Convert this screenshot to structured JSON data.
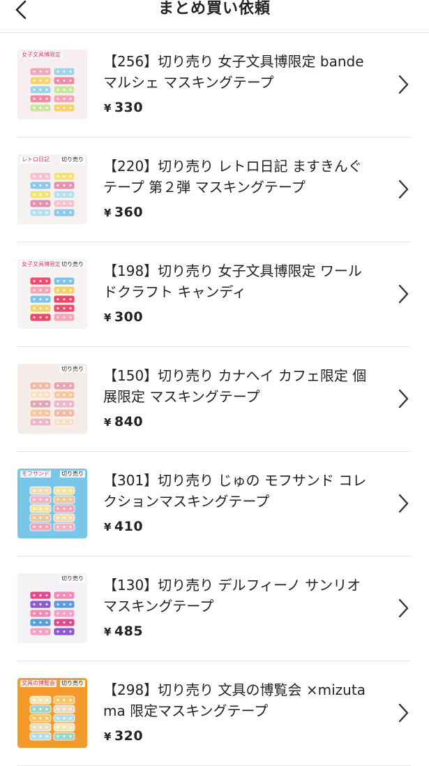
{
  "header": {
    "title": "まとめ買い依頼",
    "back_icon": "chevron-left-icon"
  },
  "items": [
    {
      "title": "【256】切り売り 女子文具博限定 bande マルシェ マスキングテープ",
      "currency": "¥",
      "price": "330",
      "thumb_caption": "女子文具博限定",
      "thumb_caption2": "",
      "thumb_bg": "#f6eef0",
      "thumb_colors": [
        "#f3a6b8",
        "#f7d36b",
        "#9fd3e8",
        "#f08aa0",
        "#c9e6a1"
      ]
    },
    {
      "title": "【220】切り売り レトロ日記 ますきんぐテープ 第２弾 マスキングテープ",
      "currency": "¥",
      "price": "360",
      "thumb_caption": "レトロ日記",
      "thumb_caption2": "切り売り",
      "thumb_bg": "#f4f1ee",
      "thumb_colors": [
        "#f4c2d0",
        "#8fc7ea",
        "#f3e27a",
        "#e88fb0",
        "#b9e0f0"
      ]
    },
    {
      "title": "【198】切り売り 女子文具博限定 ワールドクラフト キャンディ",
      "currency": "¥",
      "price": "300",
      "thumb_caption": "女子文具博限定",
      "thumb_caption2": "切り売り",
      "thumb_bg": "#f7f3f3",
      "thumb_colors": [
        "#e94f6d",
        "#f6a5b8",
        "#7fc4e8",
        "#f2d36a",
        "#e84a6a"
      ]
    },
    {
      "title": "【150】切り売り カナヘイ カフェ限定 個展限定 マスキングテープ",
      "currency": "¥",
      "price": "840",
      "thumb_caption": "",
      "thumb_caption2": "切り売り",
      "thumb_bg": "#f3ece8",
      "thumb_colors": [
        "#f4b8a6",
        "#f9e0c8",
        "#e8a4b4",
        "#f6c7a0",
        "#efb7c6"
      ]
    },
    {
      "title": "【301】切り売り じゅの モフサンド コレクションマスキングテープ",
      "currency": "¥",
      "price": "410",
      "thumb_caption": "モフサンド",
      "thumb_caption2": "切り売り",
      "thumb_bg": "#79c6e8",
      "thumb_colors": [
        "#f7d9b4",
        "#f2b4c4",
        "#f6e3a0",
        "#e9c8a2",
        "#f4a6b6"
      ]
    },
    {
      "title": "【130】切り売り デルフィーノ サンリオ マスキングテープ",
      "currency": "¥",
      "price": "485",
      "thumb_caption": "",
      "thumb_caption2": "切り売り",
      "thumb_bg": "#f4f2f4",
      "thumb_colors": [
        "#e04a8c",
        "#8a5bd0",
        "#f28ab8",
        "#5b9be0",
        "#f6a0c8"
      ]
    },
    {
      "title": "【298】切り売り 文具の博覧会 ×mizutama 限定マスキングテープ",
      "currency": "¥",
      "price": "320",
      "thumb_caption": "文具の博覧会",
      "thumb_caption2": "切り売り",
      "thumb_bg": "#f39a2a",
      "thumb_colors": [
        "#f7e7b8",
        "#9fd6c8",
        "#f5c66a",
        "#e6e0c4",
        "#b8dfe8"
      ]
    }
  ],
  "colors": {
    "text": "#222222",
    "divider": "#e6e6e6",
    "chevron": "#333333"
  }
}
